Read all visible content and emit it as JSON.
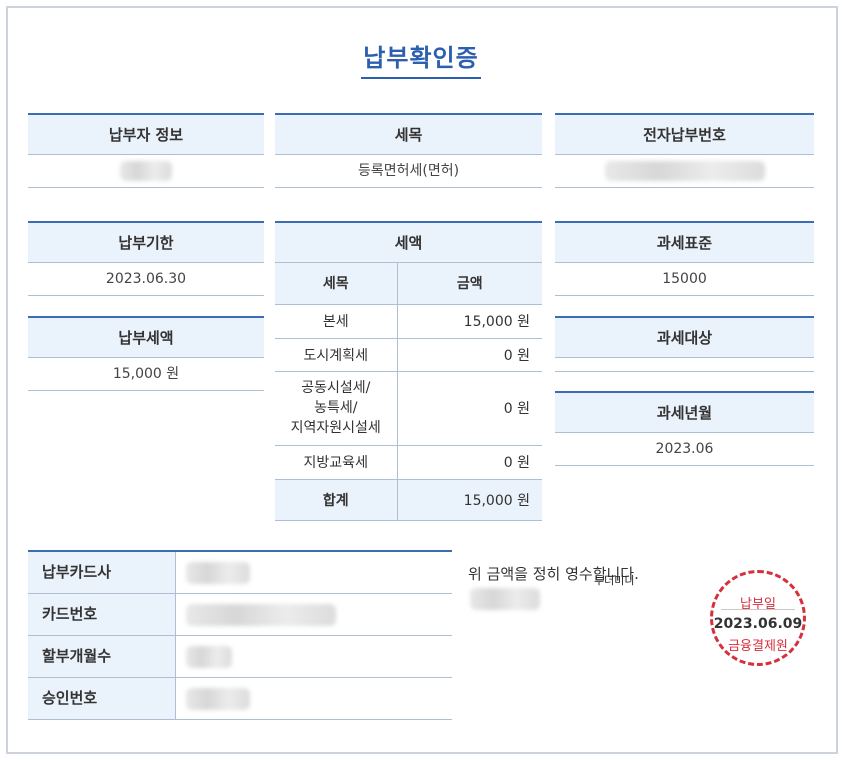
{
  "title": "납부확인증",
  "payer_info": {
    "label": "납부자 정보",
    "value": ""
  },
  "tax_item": {
    "label": "세목",
    "value": "등록면허세(면허)"
  },
  "e_payment_no": {
    "label": "전자납부번호",
    "value": ""
  },
  "due_date": {
    "label": "납부기한",
    "value": "2023.06.30"
  },
  "paid_amount": {
    "label": "납부세액",
    "value": "15,000 원"
  },
  "tax_amount": {
    "label": "세액",
    "col_item": "세목",
    "col_amount": "금액",
    "rows": [
      {
        "item": "본세",
        "amount": "15,000 원"
      },
      {
        "item": "도시계획세",
        "amount": "0 원"
      },
      {
        "item": "공동시설세/\n농특세/\n지역자원시설세",
        "amount": "0 원"
      },
      {
        "item": "지방교육세",
        "amount": "0 원"
      }
    ],
    "total_label": "합계",
    "total_amount": "15,000 원"
  },
  "tax_base": {
    "label": "과세표준",
    "value": "15000"
  },
  "tax_object": {
    "label": "과세대상",
    "value": ""
  },
  "tax_period": {
    "label": "과세년월",
    "value": "2023.06"
  },
  "payment": {
    "rows": [
      {
        "label": "납부카드사",
        "value": ""
      },
      {
        "label": "카드번호",
        "value": ""
      },
      {
        "label": "할부개월수",
        "value": ""
      },
      {
        "label": "승인번호",
        "value": ""
      }
    ]
  },
  "receipt_text": "위 금액을 정히 영수합니다.",
  "overlay_text": "투더미니",
  "stamp": {
    "top": "납부일",
    "date": "2023.06.09",
    "bottom": "금융결제원",
    "color": "#d6303c"
  },
  "colors": {
    "accent": "#3b6cb4",
    "header_bg": "#eaf2fb",
    "title": "#2d5fb0"
  }
}
